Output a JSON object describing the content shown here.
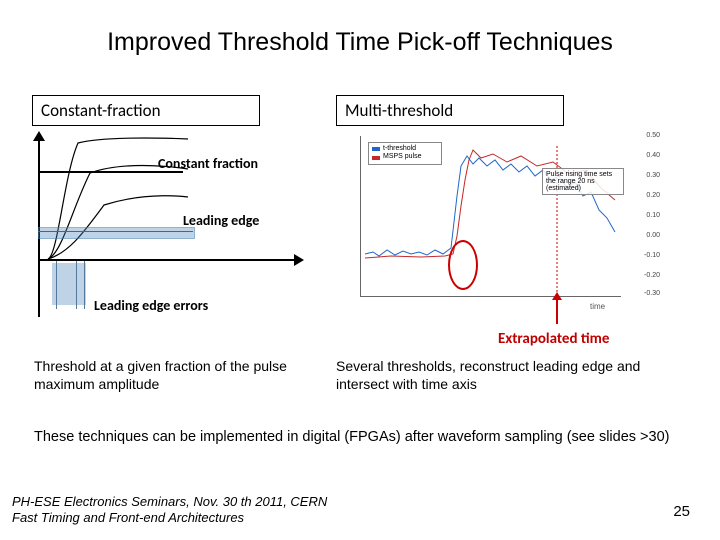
{
  "title": "Improved  Threshold Time Pick-off Techniques",
  "left": {
    "box": "Constant-fraction",
    "label_cf": "Constant fraction",
    "label_le": "Leading edge",
    "label_err": "Leading edge errors",
    "desc": "Threshold at a given fraction of the pulse maximum amplitude"
  },
  "right": {
    "box": "Multi-threshold",
    "legend": {
      "a": "t-threshold",
      "b": "MSPS pulse"
    },
    "annot": "Pulse rising time sets the range 20 ns (estimated)",
    "xlabel": "time",
    "yticks": [
      "0.50",
      "0.40",
      "0.30",
      "0.20",
      "0.10",
      "0.00",
      "-0.10",
      "-0.20",
      "-0.30"
    ],
    "extrap": "Extrapolated  time",
    "desc": "Several thresholds, reconstruct leading edge and intersect with time axis"
  },
  "bottom": "These techniques can be implemented  in digital (FPGAs) after waveform sampling (see slides >30)",
  "footer1": "PH-ESE Electronics Seminars,  Nov. 30 th 2011, CERN",
  "footer2": "Fast Timing and Front-end Architectures",
  "page": "25"
}
